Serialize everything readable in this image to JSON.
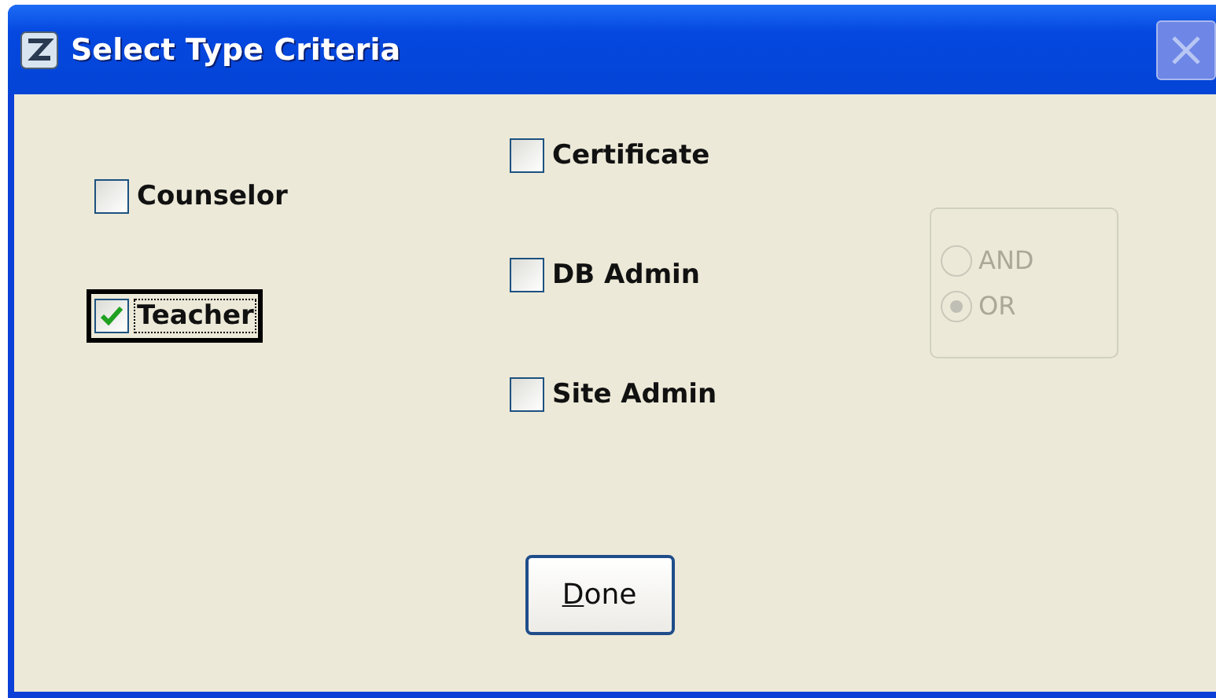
{
  "window": {
    "title": "Select Type Criteria"
  },
  "left_options": [
    {
      "label": "Counselor",
      "checked": false,
      "focused": false
    },
    {
      "label": "Teacher",
      "checked": true,
      "focused": true
    }
  ],
  "middle_options": [
    {
      "label": "Certificate",
      "checked": false,
      "focused": false
    },
    {
      "label": "DB Admin",
      "checked": false,
      "focused": false
    },
    {
      "label": "Site Admin",
      "checked": false,
      "focused": false
    }
  ],
  "logic": {
    "disabled": true,
    "options": [
      {
        "label": "AND",
        "selected": false
      },
      {
        "label": "OR",
        "selected": true
      }
    ]
  },
  "buttons": [
    {
      "label": "Done"
    }
  ]
}
